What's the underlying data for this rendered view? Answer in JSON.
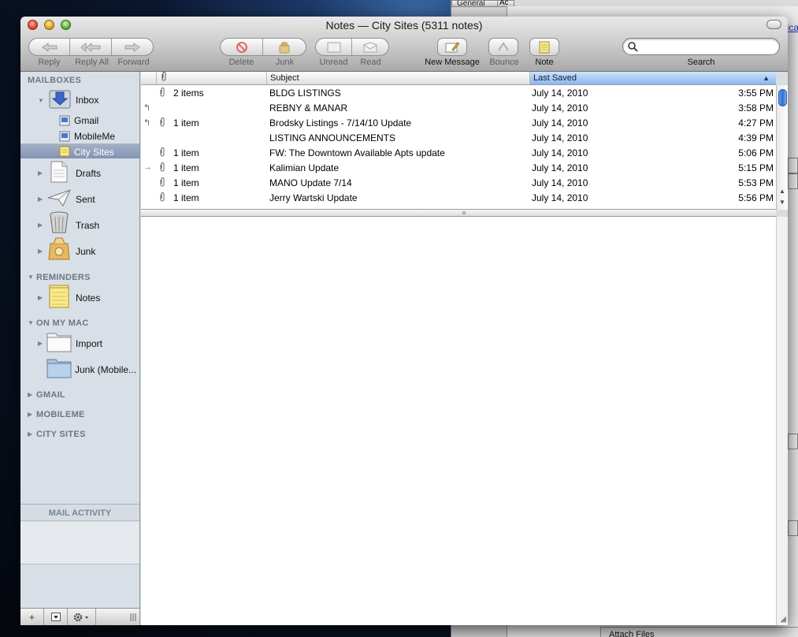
{
  "window": {
    "title": "Notes — City Sites (5311 notes)"
  },
  "toolbar": {
    "reply": "Reply",
    "reply_all": "Reply All",
    "forward": "Forward",
    "delete": "Delete",
    "junk": "Junk",
    "unread": "Unread",
    "read": "Read",
    "new_message": "New Message",
    "bounce": "Bounce",
    "note": "Note",
    "search_label": "Search",
    "search_value": ""
  },
  "sidebar": {
    "mailboxes_header": "MAILBOXES",
    "inbox": "Inbox",
    "gmail": "Gmail",
    "mobileme": "MobileMe",
    "city_sites": "City Sites",
    "drafts": "Drafts",
    "sent": "Sent",
    "trash": "Trash",
    "junk": "Junk",
    "reminders_header": "REMINDERS",
    "notes": "Notes",
    "on_my_mac_header": "ON MY MAC",
    "import": "Import",
    "junk_mobile": "Junk (Mobile...",
    "gmail_header": "GMAIL",
    "mobileme_header": "MOBILEME",
    "city_sites_header": "CITY SITES",
    "mail_activity": "MAIL ACTIVITY",
    "bottom_add": "+"
  },
  "list": {
    "columns": {
      "subject": "Subject",
      "last_saved": "Last Saved"
    },
    "rows": [
      {
        "attach": "2 items",
        "subject": "BLDG LISTINGS",
        "date": "July 14, 2010",
        "time": "3:55 PM",
        "status": "",
        "clip": true
      },
      {
        "attach": "",
        "subject": "REBNY & MANAR",
        "date": "July 14, 2010",
        "time": "3:58 PM",
        "status": "replied",
        "clip": false
      },
      {
        "attach": "1 item",
        "subject": "Brodsky Listings - 7/14/10 Update",
        "date": "July 14, 2010",
        "time": "4:27 PM",
        "status": "replied",
        "clip": true
      },
      {
        "attach": "",
        "subject": "LISTING ANNOUNCEMENTS",
        "date": "July 14, 2010",
        "time": "4:39 PM",
        "status": "",
        "clip": false
      },
      {
        "attach": "1 item",
        "subject": "FW: The Downtown Available Apts update",
        "date": "July 14, 2010",
        "time": "5:06 PM",
        "status": "",
        "clip": true
      },
      {
        "attach": "1 item",
        "subject": "Kalimian Update",
        "date": "July 14, 2010",
        "time": "5:15 PM",
        "status": "forwarded",
        "clip": true
      },
      {
        "attach": "1 item",
        "subject": "MANO Update 7/14",
        "date": "July 14, 2010",
        "time": "5:53 PM",
        "status": "",
        "clip": true
      },
      {
        "attach": "1 item",
        "subject": "Jerry Wartski Update",
        "date": "July 14, 2010",
        "time": "5:56 PM",
        "status": "",
        "clip": true
      }
    ]
  },
  "background_window": {
    "tab1": "General",
    "tab2": "Ac",
    "link": "ica",
    "attach_files": "Attach Files"
  }
}
